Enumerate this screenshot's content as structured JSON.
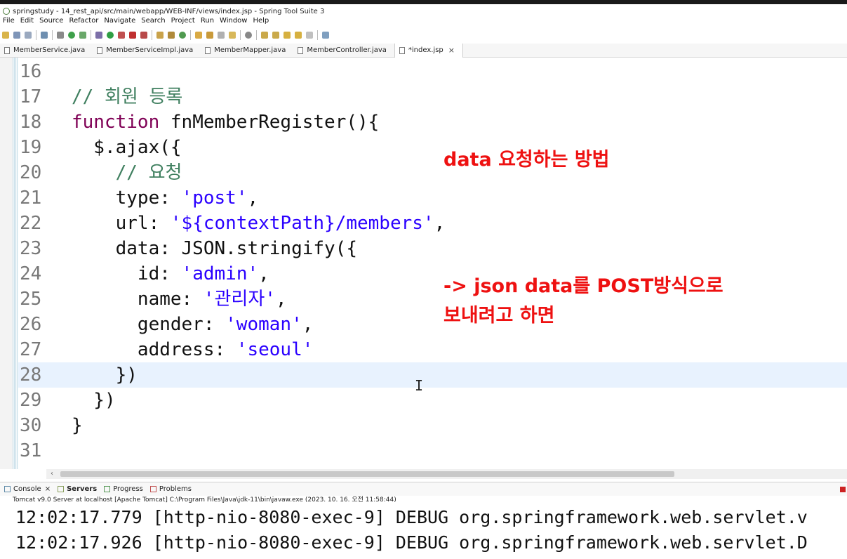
{
  "window": {
    "title": "springstudy - 14_rest_api/src/main/webapp/WEB-INF/views/index.jsp - Spring Tool Suite 3"
  },
  "menu": [
    "File",
    "Edit",
    "Source",
    "Refactor",
    "Navigate",
    "Search",
    "Project",
    "Run",
    "Window",
    "Help"
  ],
  "tabs": [
    {
      "label": "MemberService.java",
      "active": false
    },
    {
      "label": "MemberServiceImpl.java",
      "active": false
    },
    {
      "label": "MemberMapper.java",
      "active": false
    },
    {
      "label": "MemberController.java",
      "active": false
    },
    {
      "label": "*index.jsp",
      "active": true
    }
  ],
  "code": {
    "lines": [
      {
        "num": "16",
        "parts": []
      },
      {
        "num": "17",
        "parts": [
          {
            "t": "// 회원 등록",
            "c": "cm"
          }
        ]
      },
      {
        "num": "18",
        "parts": [
          {
            "t": "function",
            "c": "kw"
          },
          {
            "t": " fnMemberRegister(){",
            "c": ""
          }
        ]
      },
      {
        "num": "19",
        "parts": [
          {
            "t": "  $.ajax({",
            "c": ""
          }
        ]
      },
      {
        "num": "20",
        "parts": [
          {
            "t": "    ",
            "c": ""
          },
          {
            "t": "// 요청",
            "c": "cm"
          }
        ]
      },
      {
        "num": "21",
        "parts": [
          {
            "t": "    type: ",
            "c": ""
          },
          {
            "t": "'post'",
            "c": "str"
          },
          {
            "t": ",",
            "c": ""
          }
        ]
      },
      {
        "num": "22",
        "parts": [
          {
            "t": "    url: ",
            "c": ""
          },
          {
            "t": "'${contextPath}/members'",
            "c": "str"
          },
          {
            "t": ",",
            "c": ""
          }
        ]
      },
      {
        "num": "23",
        "parts": [
          {
            "t": "    data: JSON.stringify({",
            "c": ""
          }
        ]
      },
      {
        "num": "24",
        "parts": [
          {
            "t": "      id: ",
            "c": ""
          },
          {
            "t": "'admin'",
            "c": "str"
          },
          {
            "t": ",",
            "c": ""
          }
        ]
      },
      {
        "num": "25",
        "parts": [
          {
            "t": "      name: ",
            "c": ""
          },
          {
            "t": "'관리자'",
            "c": "str"
          },
          {
            "t": ",",
            "c": ""
          }
        ]
      },
      {
        "num": "26",
        "parts": [
          {
            "t": "      gender: ",
            "c": ""
          },
          {
            "t": "'woman'",
            "c": "str"
          },
          {
            "t": ",",
            "c": ""
          }
        ]
      },
      {
        "num": "27",
        "parts": [
          {
            "t": "      address: ",
            "c": ""
          },
          {
            "t": "'seoul'",
            "c": "str"
          }
        ]
      },
      {
        "num": "28",
        "parts": [
          {
            "t": "    })",
            "c": ""
          }
        ],
        "current": true
      },
      {
        "num": "29",
        "parts": [
          {
            "t": "  })",
            "c": ""
          }
        ]
      },
      {
        "num": "30",
        "parts": [
          {
            "t": "}",
            "c": ""
          }
        ]
      },
      {
        "num": "31",
        "parts": []
      }
    ]
  },
  "annotations": {
    "note1": "data 요청하는 방법",
    "note2_line1": "-> json data를 POST방식으로",
    "note2_line2": "보내려고 하면"
  },
  "console": {
    "tabs": [
      "Console",
      "Servers",
      "Progress",
      "Problems"
    ],
    "server_desc": "Tomcat v9.0 Server at localhost [Apache Tomcat] C:\\Program Files\\Java\\jdk-11\\bin\\javaw.exe  (2023. 10. 16. 오전 11:58:44)",
    "lines": [
      "12:02:17.779 [http-nio-8080-exec-9] DEBUG org.springframework.web.servlet.v",
      "12:02:17.926 [http-nio-8080-exec-9] DEBUG org.springframework.web.servlet.D"
    ]
  }
}
